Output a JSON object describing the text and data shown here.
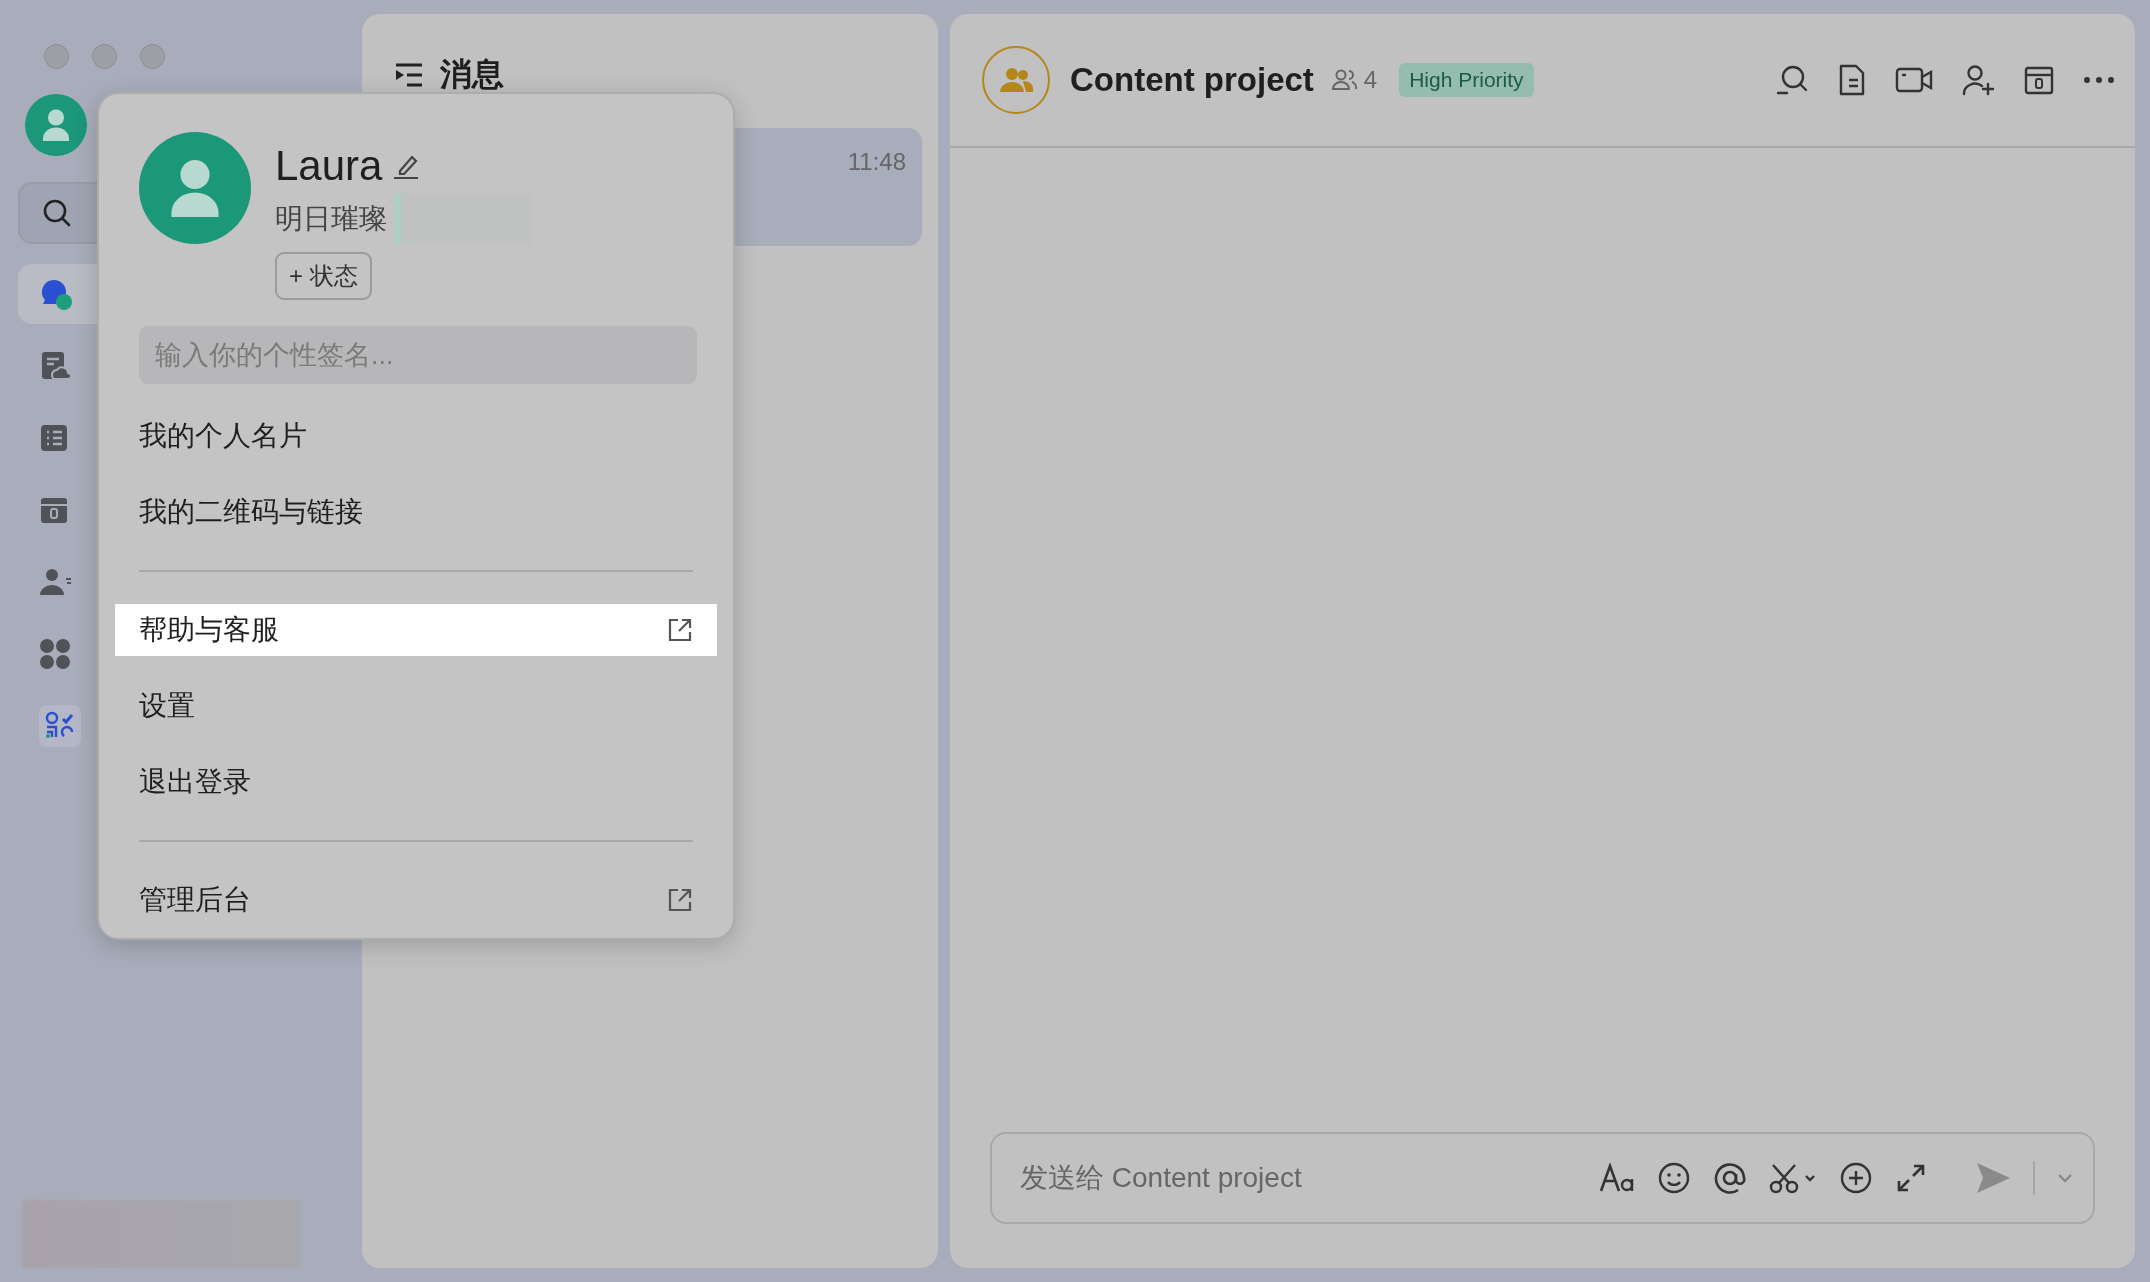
{
  "sidebar": {
    "items": [
      {
        "kind": "messages",
        "selected": true
      },
      {
        "kind": "docs",
        "selected": false
      },
      {
        "kind": "tasks",
        "selected": false
      },
      {
        "kind": "calendar",
        "selected": false
      },
      {
        "kind": "contacts",
        "selected": false
      },
      {
        "kind": "apps",
        "selected": false
      },
      {
        "kind": "more",
        "selected": false
      }
    ]
  },
  "message_list": {
    "title": "消息",
    "conversations": [
      {
        "time": "11:48",
        "selected": true
      }
    ]
  },
  "chat": {
    "title": "Content project",
    "member_count": "4",
    "tag": "High Priority",
    "composer": {
      "placeholder": "发送给 Content project"
    }
  },
  "profile_menu": {
    "name": "Laura",
    "subtitle": "明日璀璨",
    "status_button": "+ 状态",
    "signature": {
      "placeholder": "输入你的个性签名..."
    },
    "items": [
      {
        "kind": "item",
        "label": "我的个人名片",
        "external": false,
        "selected": false
      },
      {
        "kind": "item",
        "label": "我的二维码与链接",
        "external": false,
        "selected": false
      },
      {
        "kind": "divider"
      },
      {
        "kind": "item",
        "label": "帮助与客服",
        "external": true,
        "selected": true
      },
      {
        "kind": "item",
        "label": "设置",
        "external": false,
        "selected": false
      },
      {
        "kind": "item",
        "label": "退出登录",
        "external": false,
        "selected": false
      },
      {
        "kind": "divider"
      },
      {
        "kind": "item",
        "label": "管理后台",
        "external": true,
        "selected": false
      }
    ]
  }
}
